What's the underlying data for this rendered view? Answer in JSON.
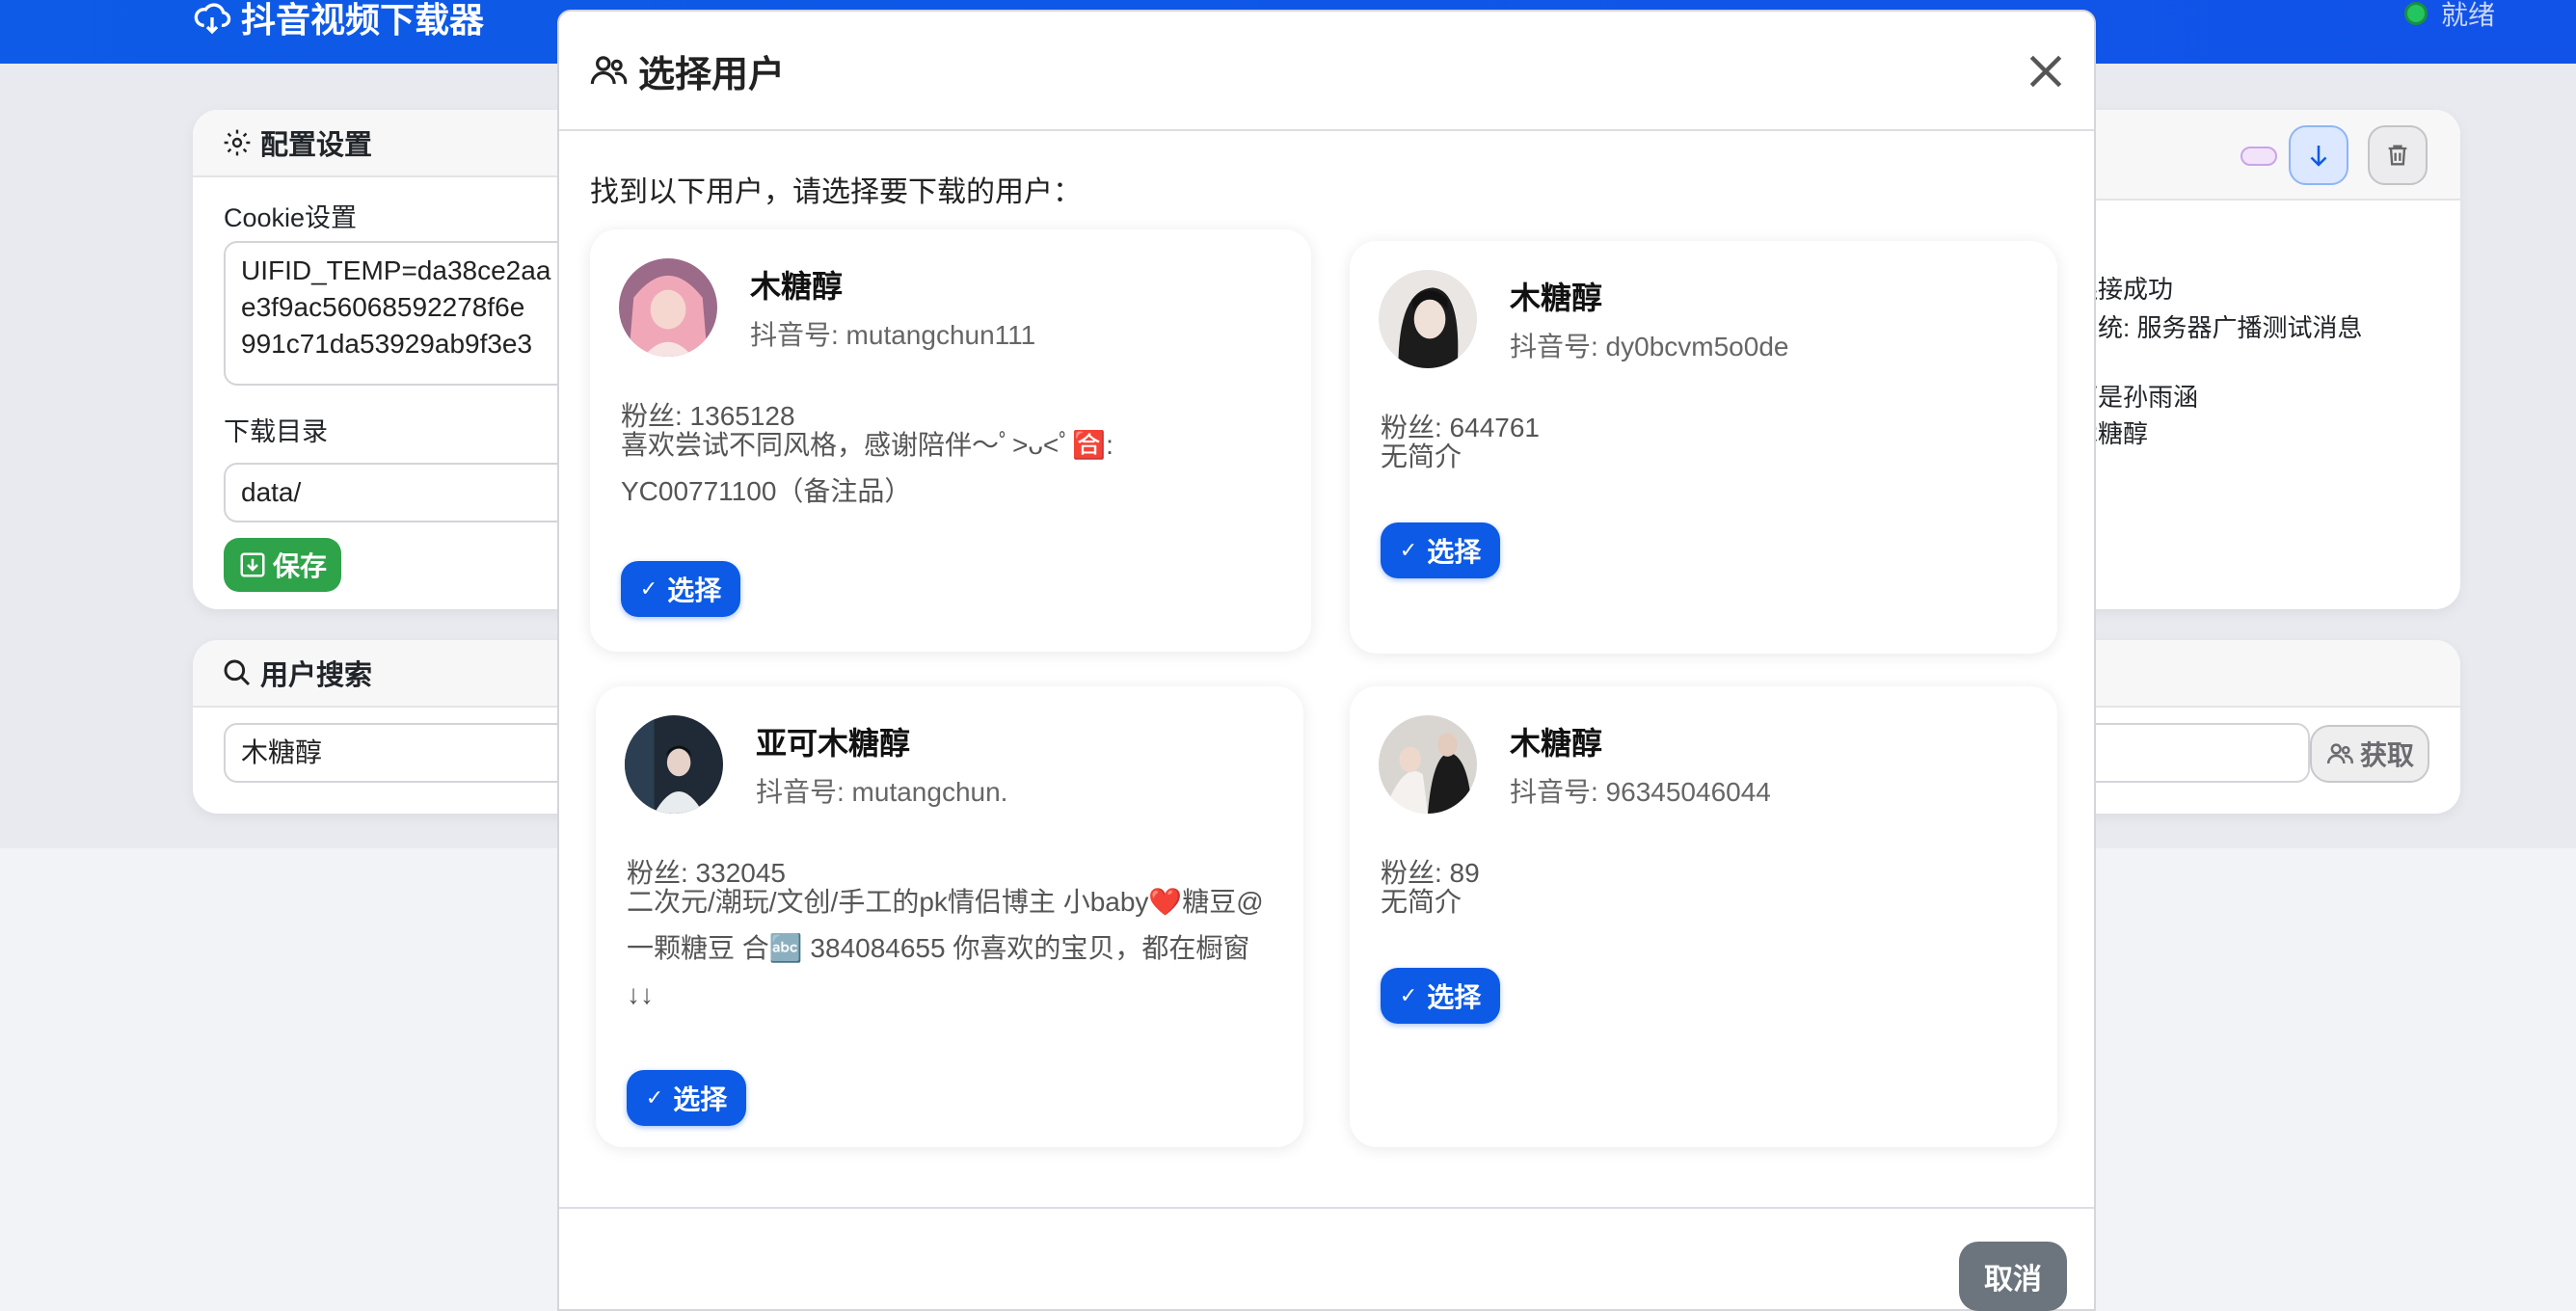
{
  "app": {
    "title": "抖音视频下载器",
    "status": "就绪"
  },
  "config": {
    "title": "配置设置",
    "cookie_label": "Cookie设置",
    "cookie_value": "UIFID_TEMP=da38ce2aa\ne3f9ac56068592278f6e\n991c71da53929ab9f3e3",
    "dir_label": "下载目录",
    "dir_value": "data/",
    "save_label": "保存"
  },
  "search": {
    "title": "用户搜索",
    "value": "木糖醇",
    "fetch_label": "获取"
  },
  "log": {
    "lines": [
      "连接成功",
      "系统: 服务器广播测试消息",
      "可是孙雨涵",
      "木糖醇"
    ]
  },
  "modal": {
    "title": "选择用户",
    "prompt": "找到以下用户，请选择要下载的用户：",
    "cancel_label": "取消",
    "select_label": "选择",
    "users": [
      {
        "name": "木糖醇",
        "id": "抖音号: mutangchun111",
        "fans": "粉丝: 1365128",
        "bio": "喜欢尝试不同风格，感谢陪伴～ﾟ˃ᴗ˂ﾟ🈴:\nYC00771100（备注品）"
      },
      {
        "name": "木糖醇",
        "id": "抖音号: dy0bcvm5o0de",
        "fans": "粉丝: 644761",
        "bio": "无简介"
      },
      {
        "name": "亚可木糖醇",
        "id": "抖音号: mutangchun.",
        "fans": "粉丝: 332045",
        "bio": "二次元/潮玩/文创/手工的pk情侣博主 小baby❤️糖豆@\n一颗糖豆 合🔤 384084655 你喜欢的宝贝，都在橱窗\n↓↓"
      },
      {
        "name": "木糖醇",
        "id": "抖音号: 96345046044",
        "fans": "粉丝: 89",
        "bio": "无简介"
      }
    ]
  },
  "colors": {
    "primary": "#0c5ae6",
    "success": "#2fa34a",
    "secondary": "#6c757d"
  }
}
